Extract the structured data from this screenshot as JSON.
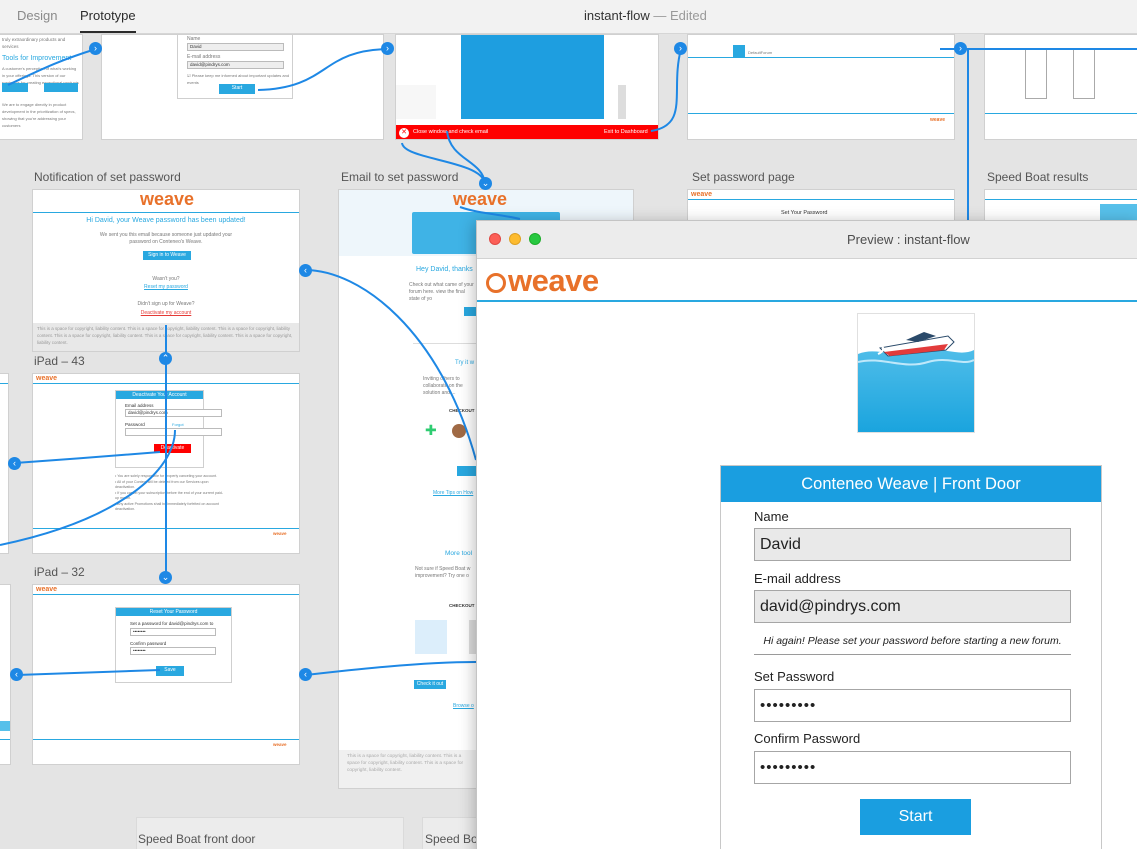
{
  "app": {
    "tabs": [
      {
        "label": "Design"
      },
      {
        "label": "Prototype"
      }
    ],
    "active_tab": "Prototype",
    "doc_title": "instant-flow",
    "doc_separator": "—",
    "doc_status": "Edited"
  },
  "artboards": {
    "notification": {
      "label": "Notification of set password",
      "logo": "weave",
      "heading": "Hi David, your Weave password has been updated!",
      "body": "We sent you this email because someone just updated your password on Conteneo's Weave.",
      "signin_button": "Sign in to Weave",
      "wasnt_you": "Wasn't you?",
      "reset_link": "Reset my password",
      "didnt_signup": "Didn't sign up for Weave?",
      "deactivate_link": "Deactivate my account",
      "footer": "This is a space for copyright, liability content. This is a space for copyright, liability content. This is a space for copyright, liability content. This is a space for copyright, liability content. This is a space for copyright, liability content. This is a space for copyright, liability content."
    },
    "email_to_set": {
      "label": "Email to set password",
      "greeting": "Hey David, thanks",
      "try_it": "Try it w",
      "checkout": "CHECKOUT SO",
      "more_tips": "More Tips on How",
      "more_tools": "More tool",
      "not_sure": "Not sure if Speed Boat w improvement? Try one o",
      "checkout2": "CHECKOUT SO",
      "check_it_out": "Check it out",
      "browse": "Browse o",
      "footer": "This is a space for copyright, liability content. This is a space for copyright, liability content. This is a space for copyright, liability content."
    },
    "set_password_page": {
      "label": "Set password page",
      "title": "Set Your Password"
    },
    "speed_boat_results": {
      "label": "Speed Boat results"
    },
    "ipad43": {
      "label": "iPad – 43",
      "panel_title": "Deactivate Your Account",
      "email_label": "Email address",
      "email_value": "david@pindrys.com",
      "password_label": "Password",
      "forgot": "Forgot password?",
      "deactivate_button": "Deactivate"
    },
    "ipad32": {
      "label": "iPad – 32",
      "panel_title": "Reset Your Password",
      "instruction": "Set a password for david@pindrys.com to continue.",
      "pwd_dots": "••••••••",
      "confirm_label": "Confirm password",
      "save_button": "Save"
    },
    "top_form": {
      "name_label": "Name",
      "name_value": "David",
      "email_label": "E-mail address",
      "email_value": "david@pindrys.com",
      "start": "Start"
    },
    "top_left": {
      "heading": "Tools for Improvement"
    },
    "top_mid": {
      "close_label": "Close window and check email",
      "exit_label": "Exit to Dashboard"
    },
    "speed_boat_front_door": {
      "label": "Speed Boat front door"
    },
    "speed_bo": {
      "label": "Speed Bo"
    }
  },
  "preview": {
    "window_title": "Preview : instant-flow",
    "logo": "weave",
    "form": {
      "title": "Conteneo Weave | Front Door",
      "name_label": "Name",
      "name_value": "David",
      "email_label": "E-mail address",
      "email_value": "david@pindrys.com",
      "note": "Hi again! Please set your password before starting a new forum.",
      "set_password_label": "Set Password",
      "set_password_value": "•••••••••",
      "confirm_password_label": "Confirm Password",
      "confirm_password_value": "•••••••••",
      "start_button": "Start"
    }
  },
  "colors": {
    "accent": "#29a8e0",
    "connector": "#1e88e5",
    "brand": "#e8712a",
    "danger": "#ff0000"
  }
}
